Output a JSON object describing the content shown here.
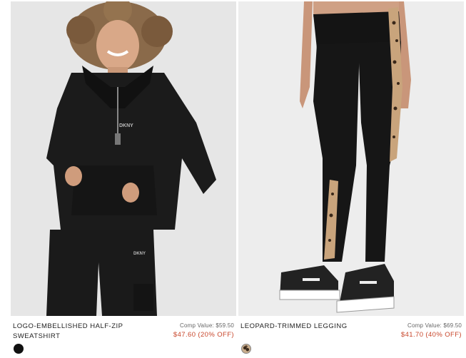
{
  "products": [
    {
      "name_line1": "LOGO-EMBELLISHED HALF-ZIP",
      "name_line2": "SWEATSHIRT",
      "comp_value": "Comp Value: $59.50",
      "sale_price": "$47.60 (20% OFF)",
      "swatch_color": "#111111",
      "image_icon": "sweatshirt-model-photo"
    },
    {
      "name_line1": "LEOPARD-TRIMMED LEGGING",
      "name_line2": "",
      "comp_value": "Comp Value: $69.50",
      "sale_price": "$41.70 (40% OFF)",
      "swatch_color": "leopard",
      "image_icon": "legging-model-photo"
    }
  ],
  "colors": {
    "sale": "#c8472c",
    "text": "#222222"
  }
}
